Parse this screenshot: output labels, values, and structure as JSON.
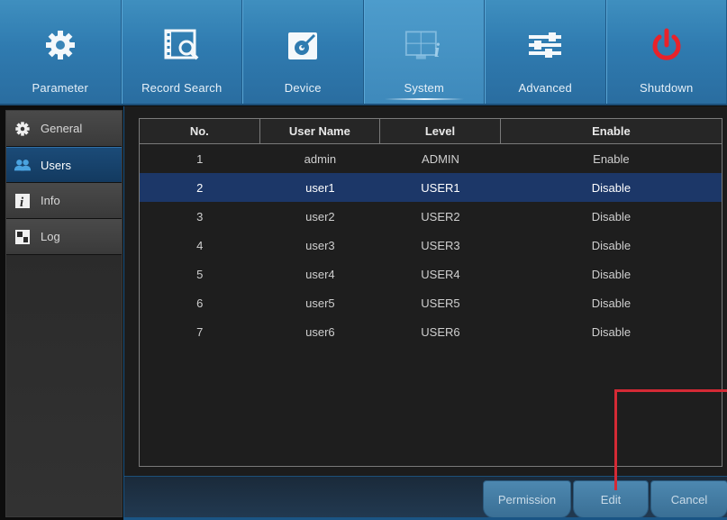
{
  "topbar": {
    "tabs": [
      {
        "label": "Parameter",
        "icon": "gear-icon"
      },
      {
        "label": "Record Search",
        "icon": "film-search-icon"
      },
      {
        "label": "Device",
        "icon": "hdd-icon"
      },
      {
        "label": "System",
        "icon": "system-info-icon"
      },
      {
        "label": "Advanced",
        "icon": "sliders-icon"
      },
      {
        "label": "Shutdown",
        "icon": "power-icon"
      }
    ],
    "active": "System"
  },
  "sidebar": {
    "items": [
      {
        "label": "General",
        "icon": "gear-icon"
      },
      {
        "label": "Users",
        "icon": "users-icon"
      },
      {
        "label": "Info",
        "icon": "info-icon"
      },
      {
        "label": "Log",
        "icon": "log-icon"
      }
    ],
    "active": "Users"
  },
  "table": {
    "headers": [
      "No.",
      "User Name",
      "Level",
      "Enable"
    ],
    "rows": [
      [
        "1",
        "admin",
        "ADMIN",
        "Enable"
      ],
      [
        "2",
        "user1",
        "USER1",
        "Disable"
      ],
      [
        "3",
        "user2",
        "USER2",
        "Disable"
      ],
      [
        "4",
        "user3",
        "USER3",
        "Disable"
      ],
      [
        "5",
        "user4",
        "USER4",
        "Disable"
      ],
      [
        "6",
        "user5",
        "USER5",
        "Disable"
      ],
      [
        "7",
        "user6",
        "USER6",
        "Disable"
      ]
    ],
    "selected_row": 2
  },
  "buttons": {
    "permission": "Permission",
    "edit": "Edit",
    "cancel": "Cancel"
  },
  "colors": {
    "accent": "#2f7bb0",
    "selected_row": "#1c3768",
    "highlight": "#d42a35",
    "shutdown_icon": "#e8222a"
  }
}
